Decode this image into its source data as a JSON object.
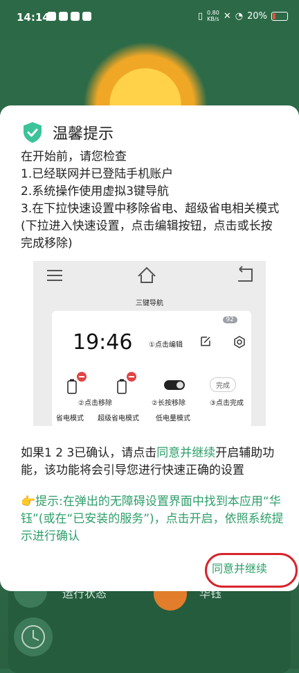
{
  "status_bar": {
    "time": "14:14",
    "net_speed": "0.80",
    "net_unit": "KB/s",
    "battery": "20%"
  },
  "background": {
    "bottom_left_label": "运行状态",
    "bottom_right_label": "华钰"
  },
  "dialog": {
    "title": "温馨提示",
    "lines": [
      "在开始前，请您检查",
      "1.已经联网并已登陆手机账户",
      "2.系统操作使用虚拟3键导航",
      "3.在下拉快速设置中移除省电、超级省电相关模式 (下拉进入快速设置，点击编辑按钮，点击或长按完成移除)"
    ],
    "illustration": {
      "nav_caption": "三键导航",
      "clock": "19:46",
      "edit_label": "①点击编辑",
      "badge": "92",
      "remove_label": "②点击移除",
      "longpress_label": "②长按移除",
      "done_chip": "完成",
      "done_label": "③点击完成",
      "mode1": "省电模式",
      "mode2": "超级省电模式",
      "mode3": "低电量模式"
    },
    "confirm_prefix": "如果1 2 3已确认，请点击",
    "confirm_link": "同意并继续",
    "confirm_suffix": "开启辅助功能，该功能将会引导您进行快速正确的设置",
    "hint_icon": "👉",
    "hint": "提示:在弹出的无障碍设置界面中找到本应用“华钰”(或在“已安装的服务”)，点击开启，依照系统提示进行确认",
    "agree_button": "同意并继续"
  },
  "colors": {
    "accent": "#2e9e6a",
    "highlight_ring": "#d8232a",
    "background": "#2f6a4a"
  }
}
